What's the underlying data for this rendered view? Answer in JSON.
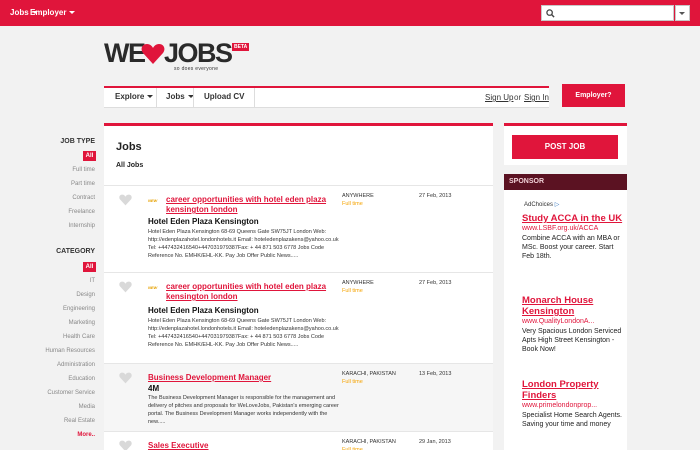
{
  "topbar": {
    "menu1": "Jobs",
    "menu2": "Employer",
    "search_placeholder": ""
  },
  "logo": {
    "brand_left": "WE",
    "brand_right": "JOBS",
    "badge": "BETA",
    "tagline": "so does everyone"
  },
  "nav": {
    "explore": "Explore",
    "jobs": "Jobs",
    "upload_cv": "Upload CV",
    "signup": "Sign Up",
    "or": "or",
    "signin": "Sign In",
    "employer_button": "Employer?"
  },
  "sidebar": {
    "job_type_heading": "JOB TYPE",
    "job_type_all": "All",
    "job_types": [
      "Full time",
      "Part time",
      "Contract",
      "Freelance",
      "Internship"
    ],
    "category_heading": "CATEGORY",
    "category_all": "All",
    "categories": [
      "IT",
      "Design",
      "Engineering",
      "Marketing",
      "Health Care",
      "Human Resources",
      "Administration",
      "Education",
      "Customer Service",
      "Media",
      "Real Estate"
    ],
    "more": "More.."
  },
  "main": {
    "title": "Jobs",
    "subtitle": "All Jobs",
    "jobs": [
      {
        "new_badge": "NEW",
        "title": "career opportunities with hotel eden plaza kensington london",
        "company": "Hotel Eden Plaza Kensington",
        "description": "Hotel Eden Plaza Kensington 68-69 Queens Gate SW75JT London Web: http://edenplazahotel.londonhotels.it Email: hoteledenplazakens@yahoo.co.uk Tel: +447432416540+447031979387Fax: + 44 871 503 6778 Jobs Code Reference No. EMHK/EHL-KK. Pay Job Offer Public News.....",
        "location": "ANYWHERE",
        "type": "Full time",
        "date": "27 Feb, 2013"
      },
      {
        "new_badge": "NEW",
        "title": "career opportunities with hotel eden plaza kensington london",
        "company": "Hotel Eden Plaza Kensington",
        "description": "Hotel Eden Plaza Kensington 68-69 Queens Gate SW75JT London Web: http://edenplazahotel.londonhotels.it Email: hoteledenplazakens@yahoo.co.uk Tel: +447432416540+447031979387Fax: + 44 871 503 6778 Jobs Code Reference No. EMHK/EHL-KK. Pay Job Offer Public News.....",
        "location": "ANYWHERE",
        "type": "Full time",
        "date": "27 Feb, 2013"
      },
      {
        "new_badge": "",
        "title": "Business Development Manager",
        "company": "4M",
        "description": "The Business Development Manager is responsible for the management and delivery of pitches and proposals for WeLoveJobs, Pakistan's emerging career portal. The Business Development Manager works independently with the new.....",
        "location": "KARACHI, PAKISTAN",
        "type": "Full time",
        "date": "13 Feb, 2013"
      },
      {
        "new_badge": "",
        "title": "Sales Executive",
        "company": "",
        "description": "",
        "location": "KARACHI, PAKISTAN",
        "type": "Full time",
        "date": "29 Jan, 2013"
      }
    ]
  },
  "right": {
    "post_job": "POST JOB",
    "sponsor_heading": "SPONSOR",
    "adchoices": "AdChoices",
    "ads": [
      {
        "headline": "Study ACCA in the UK",
        "url": "www.LSBF.org.uk/ACCA",
        "body": "Combine ACCA with an MBA or MSc. Boost your career. Start Feb 18th."
      },
      {
        "headline": "Monarch House Kensington",
        "url": "www.QualityLondonA...",
        "body": "Very Spacious London Serviced Apts High Street Kensington - Book Now!"
      },
      {
        "headline": "London Property Finders",
        "url": "www.primelondonprop...",
        "body": "Specialist Home Search Agents. Saving your time and money"
      }
    ]
  },
  "colors": {
    "accent": "#e0153b",
    "sponsor_header": "#5b1222",
    "job_type_text": "#f5a300"
  }
}
